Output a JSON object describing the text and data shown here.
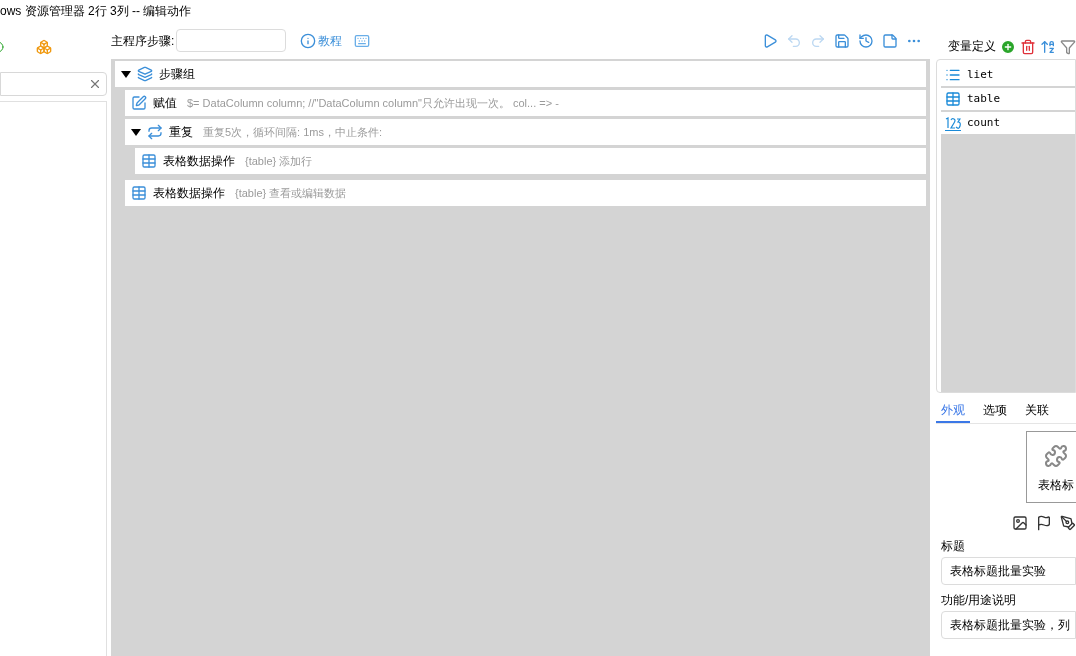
{
  "window": {
    "title": "ows 资源管理器 2行 3列 -- 编辑动作"
  },
  "main": {
    "step_label": "主程序步骤:",
    "tutorial": "教程"
  },
  "steps": [
    {
      "kind": "group",
      "name": "步骤组",
      "expanded": true,
      "children": [
        {
          "kind": "assign",
          "name": "赋值",
          "detail": "$=  DataColumn column; //\"DataColumn column\"只允许出现一次。  col... => -"
        },
        {
          "kind": "repeat",
          "name": "重复",
          "detail": "重复5次，循环间隔: 1ms，中止条件:",
          "expanded": true,
          "children": [
            {
              "kind": "table",
              "name": "表格数据操作",
              "detail": "{table} 添加行"
            }
          ]
        },
        {
          "kind": "table",
          "name": "表格数据操作",
          "detail": "{table} 查看或编辑数据"
        }
      ]
    }
  ],
  "variables": {
    "title": "变量定义",
    "items": [
      {
        "kind": "list",
        "name": "liet"
      },
      {
        "kind": "table",
        "name": "table"
      },
      {
        "kind": "number",
        "name": "count"
      }
    ]
  },
  "tabs": [
    {
      "label": "外观",
      "selected": true
    },
    {
      "label": "选项",
      "selected": false
    },
    {
      "label": "关联",
      "selected": false
    }
  ],
  "preview": {
    "caption": "表格标"
  },
  "fields": [
    {
      "label": "标题",
      "value": "表格标题批量实验"
    },
    {
      "label": "功能/用途说明",
      "value": "表格标题批量实验，列"
    }
  ]
}
